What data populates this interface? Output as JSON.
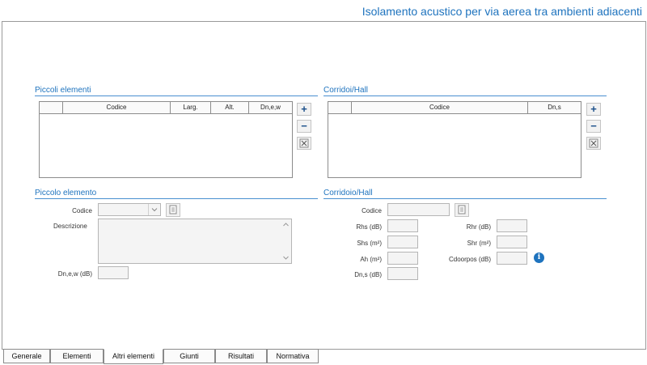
{
  "window": {
    "title": "Isolamento acustico per via aerea tra ambienti adiacenti"
  },
  "piccoli_elementi": {
    "title": "Piccoli elementi",
    "columns": [
      "Codice",
      "Larg.",
      "Alt.",
      "Dn,e,w"
    ]
  },
  "corridoi_hall": {
    "title": "Corridoi/Hall",
    "columns": [
      "Codice",
      "Dn,s"
    ]
  },
  "buttons": {
    "add": "+",
    "remove": "−"
  },
  "piccolo_elemento": {
    "title": "Piccolo elemento",
    "codice_label": "Codice",
    "codice_value": "",
    "descrizione_label": "Descrizione",
    "descrizione_value": "",
    "dnew_label": "Dn,e,w (dB)",
    "dnew_value": ""
  },
  "corridoio_hall": {
    "title": "Corridoio/Hall",
    "codice_label": "Codice",
    "codice_value": "",
    "rhs_label": "Rhs (dB)",
    "rhr_label": "Rhr (dB)",
    "shs_label": "Shs (m²)",
    "shr_label": "Shr (m²)",
    "ah_label": "Ah (m²)",
    "cdoorpos_label": "Cdoorpos (dB)",
    "dns_label": "Dn,s (dB)",
    "info_icon": "i"
  },
  "tabs": [
    "Generale",
    "Elementi",
    "Altri elementi",
    "Giunti",
    "Risultati",
    "Normativa"
  ],
  "active_tab": "Altri elementi",
  "colors": {
    "accent": "#1e73be",
    "border": "#8c8c8c"
  }
}
